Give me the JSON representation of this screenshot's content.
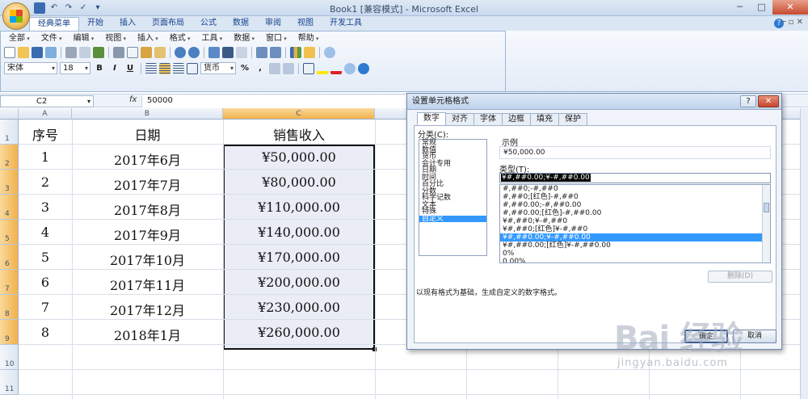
{
  "window": {
    "title": "Book1  [兼容模式] - Microsoft Excel",
    "minimize": "─",
    "maximize": "□",
    "close": "✕"
  },
  "ribbon_tabs": [
    "经典菜单",
    "开始",
    "插入",
    "页面布局",
    "公式",
    "数据",
    "审阅",
    "视图",
    "开发工具"
  ],
  "ribbon_controls": {
    "help": "?",
    "minimize": "─",
    "restore": "▫",
    "close": "✕"
  },
  "classic_menu": [
    "全部",
    "文件",
    "编辑",
    "视图",
    "插入",
    "格式",
    "工具",
    "数据",
    "窗口",
    "帮助"
  ],
  "toolbar": {
    "font_name": "宋体",
    "font_size": "18",
    "bold": "B",
    "italic": "I",
    "underline": "U",
    "number_format": "货币",
    "percent": "%",
    "comma": ","
  },
  "formula_bar": {
    "name_box": "C2",
    "fx": "fx",
    "value": "50000"
  },
  "sheet": {
    "columns": [
      "A",
      "B",
      "C"
    ],
    "rows": [
      "1",
      "2",
      "3",
      "4",
      "5",
      "6",
      "7",
      "8",
      "9",
      "10",
      "11"
    ],
    "headers": [
      "序号",
      "日期",
      "销售收入"
    ],
    "data": [
      [
        "1",
        "2017年6月",
        "¥50,000.00"
      ],
      [
        "2",
        "2017年7月",
        "¥80,000.00"
      ],
      [
        "3",
        "2017年8月",
        "¥110,000.00"
      ],
      [
        "4",
        "2017年9月",
        "¥140,000.00"
      ],
      [
        "5",
        "2017年10月",
        "¥170,000.00"
      ],
      [
        "6",
        "2017年11月",
        "¥200,000.00"
      ],
      [
        "7",
        "2017年12月",
        "¥230,000.00"
      ],
      [
        "8",
        "2018年1月",
        "¥260,000.00"
      ]
    ]
  },
  "dialog": {
    "title": "设置单元格格式",
    "help_btn": "?",
    "close_btn": "✕",
    "tabs": [
      "数字",
      "对齐",
      "字体",
      "边框",
      "填充",
      "保护"
    ],
    "category_label": "分类(C):",
    "categories": [
      "常规",
      "数值",
      "货币",
      "会计专用",
      "日期",
      "时间",
      "百分比",
      "分数",
      "科学记数",
      "文本",
      "特殊",
      "自定义"
    ],
    "selected_category": "自定义",
    "sample_label": "示例",
    "sample_value": "¥50,000.00",
    "type_label": "类型(T):",
    "type_value": "¥#,##0.00;¥-#,##0.00",
    "types": [
      "#,##0;-#,##0",
      "#,##0;[红色]-#,##0",
      "#,##0.00;-#,##0.00",
      "#,##0.00;[红色]-#,##0.00",
      "¥#,##0;¥-#,##0",
      "¥#,##0;[红色]¥-#,##0",
      "¥#,##0.00;¥-#,##0.00",
      "¥#,##0.00;[红色]¥-#,##0.00",
      "0%",
      "0.00%",
      "0.00E+00"
    ],
    "selected_type_index": 6,
    "delete_btn": "删除(D)",
    "note": "以现有格式为基础，生成自定义的数字格式。",
    "ok_btn": "确定",
    "cancel_btn": "取消"
  },
  "watermark": {
    "main": "Bai 经验",
    "sub": "jingyan.baidu.com"
  },
  "colors": {
    "selection_fill": "#eaedf6",
    "header_highlight": "#f1b14c",
    "list_highlight": "#3399ff"
  }
}
